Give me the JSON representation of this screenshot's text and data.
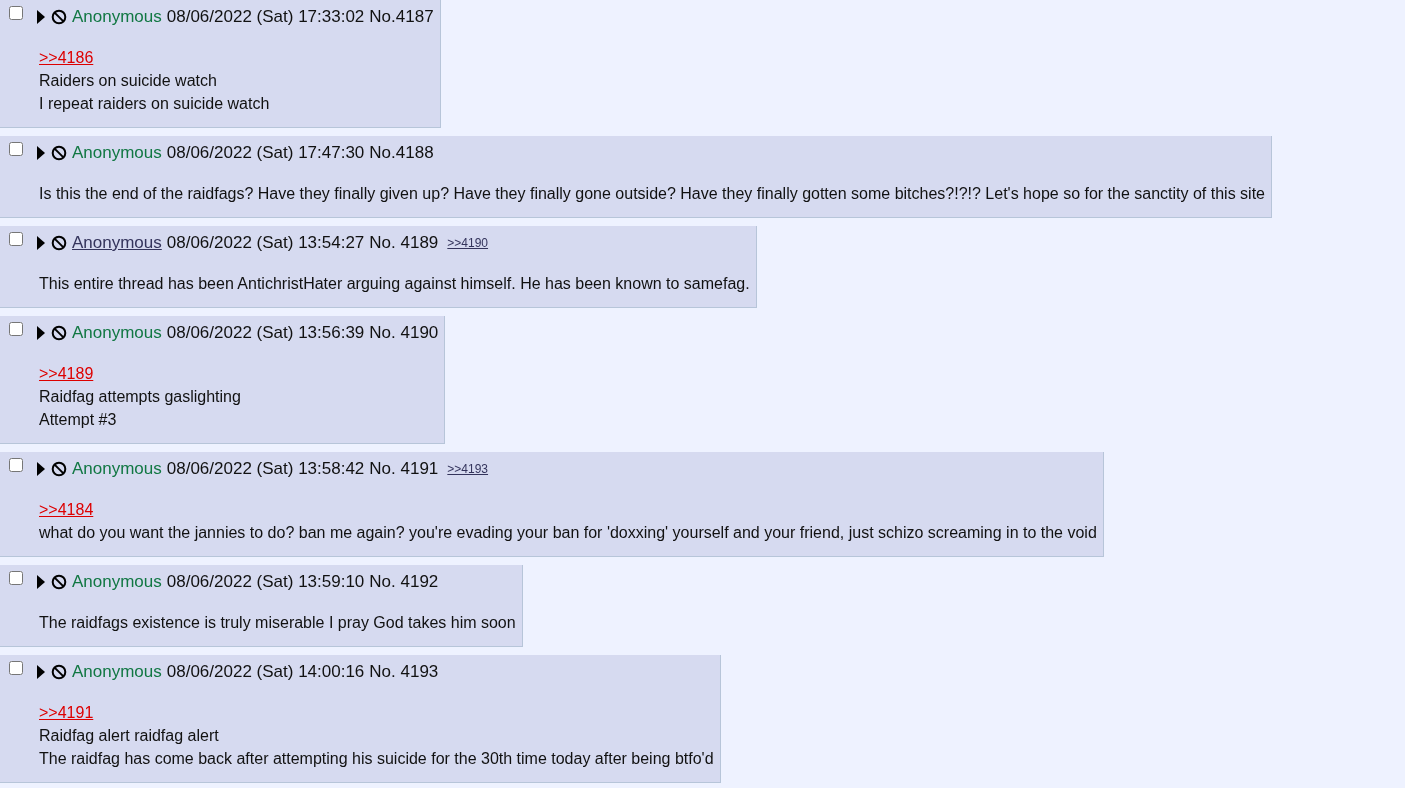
{
  "posts": [
    {
      "checked": false,
      "name": "Anonymous",
      "name_linked": false,
      "date": "08/06/2022 (Sat) 17:33:02",
      "number": "No.4187",
      "body": [
        {
          "kind": "quote",
          "text": ">>4186"
        },
        {
          "kind": "text",
          "text": "Raiders on suicide watch"
        },
        {
          "kind": "text",
          "text": "I repeat raiders on suicide watch"
        }
      ]
    },
    {
      "checked": false,
      "name": "Anonymous",
      "name_linked": false,
      "date": "08/06/2022 (Sat) 17:47:30",
      "number": "No.4188",
      "body": [
        {
          "kind": "text",
          "text": "Is this the end of the raidfags? Have they finally given up? Have they finally gone outside? Have they finally gotten some bitches?!?!? Let's hope so for the sanctity of this site"
        }
      ]
    },
    {
      "checked": false,
      "name": "Anonymous",
      "name_linked": true,
      "date": "08/06/2022 (Sat) 13:54:27",
      "number": "No. 4189",
      "backlinks": [
        ">>4190"
      ],
      "body": [
        {
          "kind": "text",
          "text": "This entire thread has been AntichristHater arguing against himself. He has been known to samefag."
        }
      ]
    },
    {
      "checked": false,
      "name": "Anonymous",
      "name_linked": false,
      "date": "08/06/2022 (Sat) 13:56:39",
      "number": "No. 4190",
      "body": [
        {
          "kind": "quote",
          "text": ">>4189"
        },
        {
          "kind": "text",
          "text": "Raidfag attempts gaslighting"
        },
        {
          "kind": "text",
          "text": "Attempt #3"
        }
      ]
    },
    {
      "checked": false,
      "name": "Anonymous",
      "name_linked": false,
      "date": "08/06/2022 (Sat) 13:58:42",
      "number": "No. 4191",
      "backlinks": [
        ">>4193"
      ],
      "body": [
        {
          "kind": "quote",
          "text": ">>4184"
        },
        {
          "kind": "text",
          "text": "what do you want the jannies to do? ban me again? you're evading your ban for 'doxxing' yourself and your friend, just schizo screaming in to the void"
        }
      ]
    },
    {
      "checked": false,
      "name": "Anonymous",
      "name_linked": false,
      "date": "08/06/2022 (Sat) 13:59:10",
      "number": "No. 4192",
      "body": [
        {
          "kind": "text",
          "text": "The raidfags existence is truly miserable I pray God takes him soon"
        }
      ]
    },
    {
      "checked": false,
      "name": "Anonymous",
      "name_linked": false,
      "date": "08/06/2022 (Sat) 14:00:16",
      "number": "No. 4193",
      "body": [
        {
          "kind": "quote",
          "text": ">>4191"
        },
        {
          "kind": "text",
          "text": "Raidfag alert raidfag alert"
        },
        {
          "kind": "text",
          "text": "The raidfag has come back after attempting his suicide for the 30th time today after being btfo'd"
        }
      ]
    }
  ]
}
